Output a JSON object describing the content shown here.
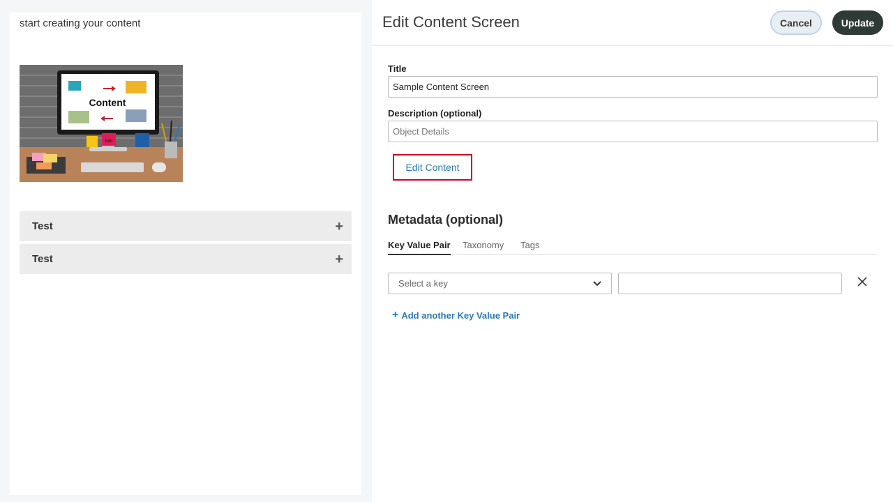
{
  "preview": {
    "intro_text": "start creating your content",
    "image": {
      "screen_word": "Content",
      "note_label": "Edit"
    },
    "accordions": [
      {
        "label": "Test",
        "icon": "plus-icon"
      },
      {
        "label": "Test",
        "icon": "plus-icon"
      }
    ]
  },
  "editor": {
    "title": "Edit Content Screen",
    "cancel_label": "Cancel",
    "update_label": "Update",
    "title_field": {
      "label": "Title",
      "value": "Sample Content Screen"
    },
    "description_field": {
      "label": "Description (optional)",
      "placeholder": "Object Details"
    },
    "edit_content_label": "Edit Content",
    "metadata": {
      "heading": "Metadata (optional)",
      "tabs": [
        "Key Value Pair",
        "Taxonomy",
        "Tags"
      ],
      "active_tab": "Key Value Pair",
      "key_select_placeholder": "Select a key",
      "add_pair_label": "Add another Key Value Pair"
    }
  },
  "colors": {
    "accent_link": "#2a7ab8",
    "update_button": "#2f3a36",
    "highlight_border": "#d0021b"
  }
}
